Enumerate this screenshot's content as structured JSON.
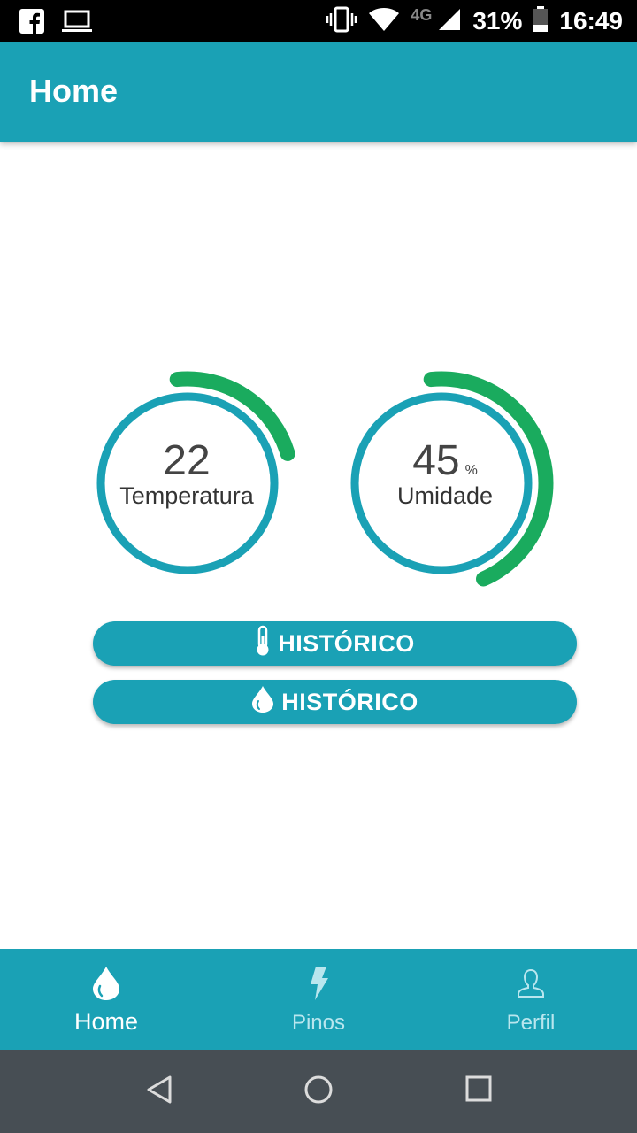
{
  "status_bar": {
    "network_type": "4G",
    "battery": "31%",
    "time": "16:49"
  },
  "app_bar": {
    "title": "Home"
  },
  "gauges": [
    {
      "value": "22",
      "unit": "",
      "label": "Temperatura",
      "arc_fraction": 0.22
    },
    {
      "value": "45",
      "unit": "%",
      "label": "Umidade",
      "arc_fraction": 0.45
    }
  ],
  "buttons": {
    "temperature_history": "HISTÓRICO",
    "humidity_history": "HISTÓRICO"
  },
  "bottom_nav": {
    "items": [
      {
        "label": "Home",
        "icon": "drop-icon",
        "active": true
      },
      {
        "label": "Pinos",
        "icon": "bolt-icon",
        "active": false
      },
      {
        "label": "Perfil",
        "icon": "person-icon",
        "active": false
      }
    ]
  },
  "colors": {
    "primary": "#1aa1b5",
    "gauge_arc": "#1aab5e",
    "system_nav": "#474e54"
  }
}
